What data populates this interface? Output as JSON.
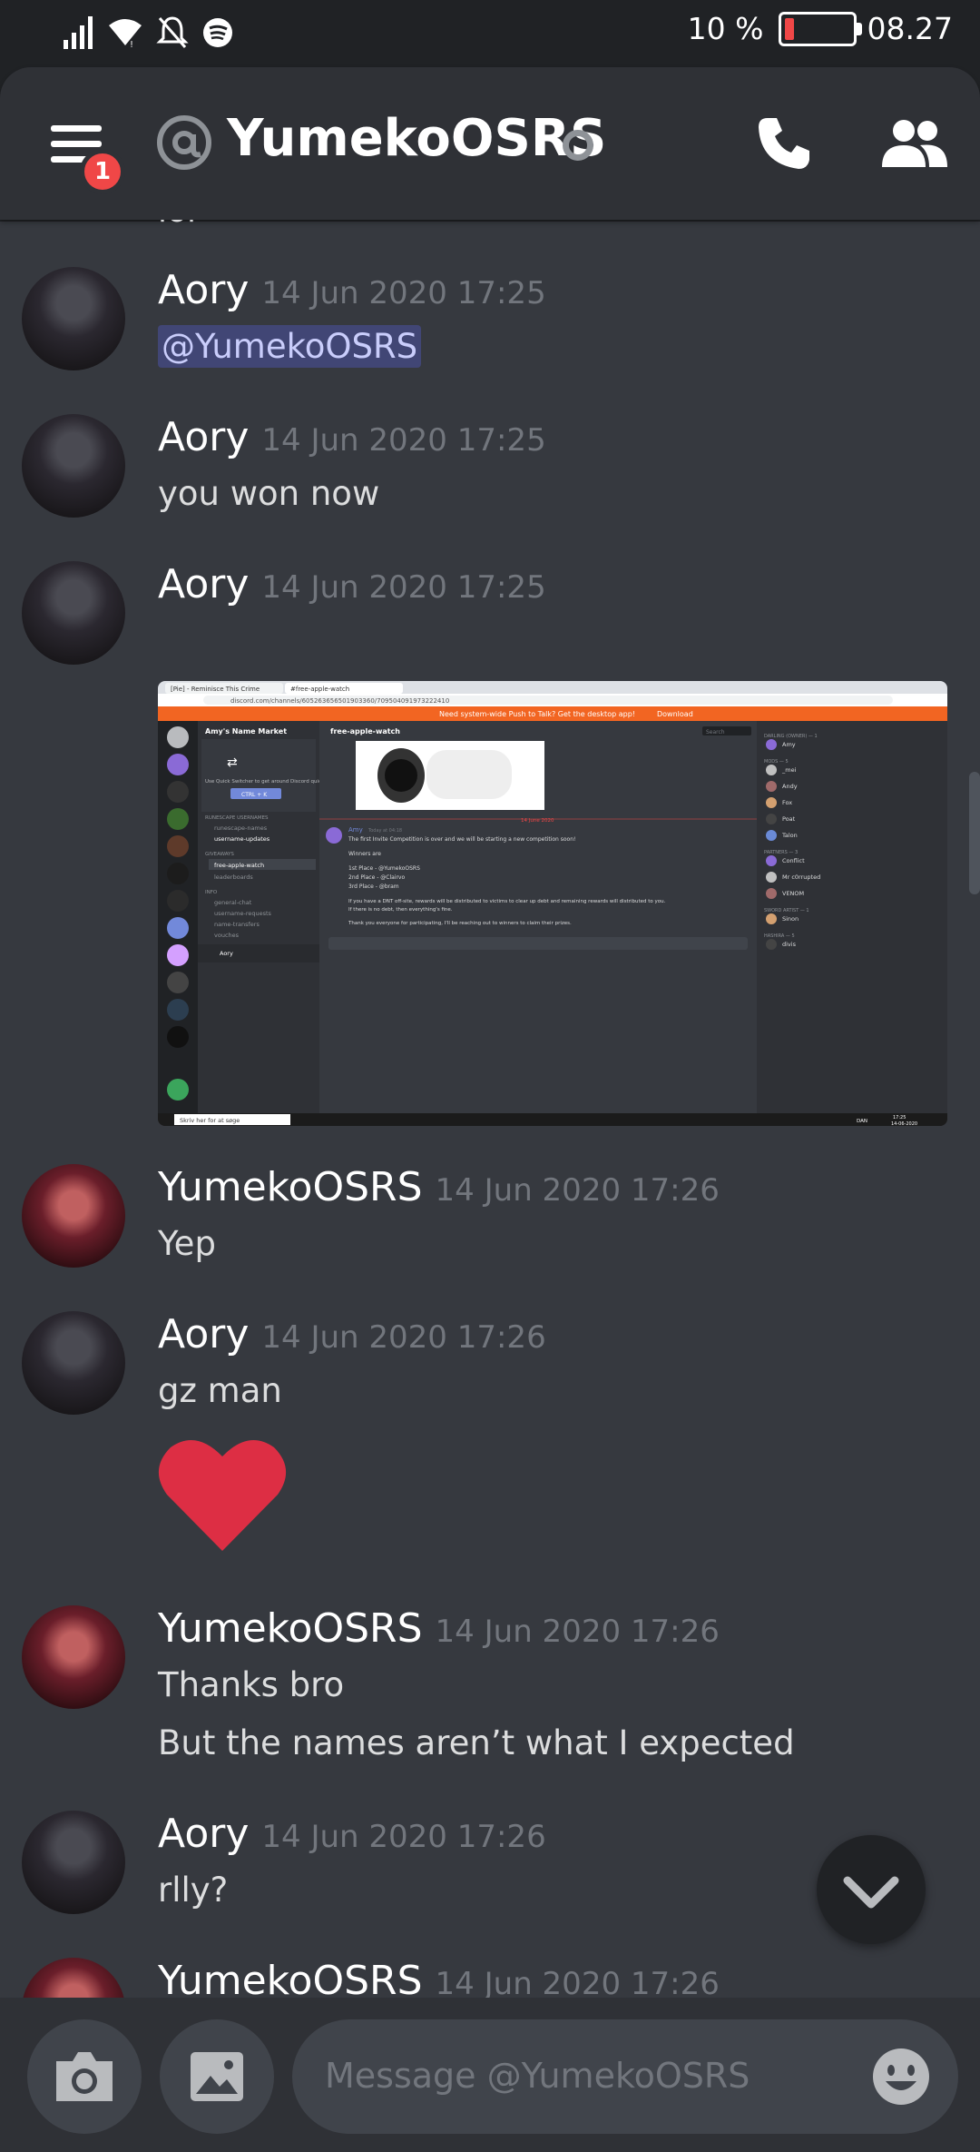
{
  "statusbar": {
    "battery": "10 %",
    "clock": "08.27"
  },
  "header": {
    "title": "YumekoOSRS",
    "notification_count": "1"
  },
  "cutoff_text": "lol",
  "messages": [
    {
      "author": "Aory",
      "time": "14 Jun 2020 17:25",
      "lines": [
        "@YumekoOSRS"
      ]
    },
    {
      "author": "Aory",
      "time": "14 Jun 2020 17:25",
      "lines": [
        "you won now"
      ]
    },
    {
      "author": "Aory",
      "time": "14 Jun 2020 17:25",
      "lines": []
    },
    {
      "author": "YumekoOSRS",
      "time": "14 Jun 2020 17:26",
      "lines": [
        "Yep"
      ]
    },
    {
      "author": "Aory",
      "time": "14 Jun 2020 17:26",
      "lines": [
        "gz man"
      ]
    },
    {
      "author": "YumekoOSRS",
      "time": "14 Jun 2020 17:26",
      "lines": [
        "Thanks bro",
        "But the names aren’t what I expected"
      ]
    },
    {
      "author": "Aory",
      "time": "14 Jun 2020 17:26",
      "lines": [
        "rlly?"
      ]
    },
    {
      "author": "YumekoOSRS",
      "time": "14 Jun 2020 17:26",
      "lines": []
    }
  ],
  "embed": {
    "tab_1": "[Pie] - Reminisce This Crime",
    "tab_2": "#free-apple-watch",
    "url": "discord.com/channels/605263656501903360/709504091973222410",
    "banner": "Need system-wide Push to Talk? Get the desktop app!",
    "banner_action": "Download",
    "server_name": "Amy's Name Market",
    "channel_title": "free-apple-watch",
    "search": "Search",
    "quick_switcher": "Use Quick Switcher to get around Discord quickly. Just press:",
    "shortcut": "CTRL + K",
    "cat_1": "RUNESCAPE USERNAMES",
    "channels_1": [
      "runescape-names",
      "username-updates"
    ],
    "cat_2": "GIVEAWAYS",
    "channels_2": [
      "free-apple-watch",
      "leaderboards"
    ],
    "cat_3": "INFO",
    "channels_3": [
      "general-chat",
      "username-requests",
      "name-transfers",
      "vouches"
    ],
    "divider_date": "14 June 2020",
    "post_author": "Amy",
    "post_time": "Today at 04:18",
    "post_lines": [
      "The first Invite Competition is over and we will be starting a new competition soon!",
      "Winners are",
      "1st Place - @YumekoOSRS",
      "2nd Place - @Clairvo",
      "3rd Place - @bram",
      "If you have a DNT off-site, rewards will be distributed to victims to clear up debt and remaining rewards will distributed to you.",
      "If there is no debt, then everything's fine.",
      "Thank you everyone for participating, I'll be reaching out to winners to claim their prizes."
    ],
    "user_name": "Aory",
    "members": [
      {
        "role": "DARLING (OWNER) — 1",
        "name": "Amy"
      },
      {
        "role": "MODS — 5",
        "name": "_mei"
      },
      {
        "role": "",
        "name": "Andy"
      },
      {
        "role": "",
        "name": "Fox"
      },
      {
        "role": "",
        "name": "Poat"
      },
      {
        "role": "",
        "name": "Talon"
      },
      {
        "role": "PARTNERS — 3",
        "name": "Conflict"
      },
      {
        "role": "",
        "name": "Mr c0rrupted"
      },
      {
        "role": "",
        "name": "VENOM"
      },
      {
        "role": "SWORD ARTIST — 1",
        "name": "Sinon"
      },
      {
        "role": "HASHIRA — 5",
        "name": "divis"
      }
    ],
    "taskbar_search": "Skriv her for at søge",
    "taskbar_lang": "DAN",
    "taskbar_time": "17:25",
    "taskbar_date": "14-06-2020"
  },
  "composer": {
    "placeholder": "Message @YumekoOSRS"
  },
  "colors": {
    "accent": "#7289da",
    "heart": "#dd2e44",
    "badge": "#f04747"
  }
}
